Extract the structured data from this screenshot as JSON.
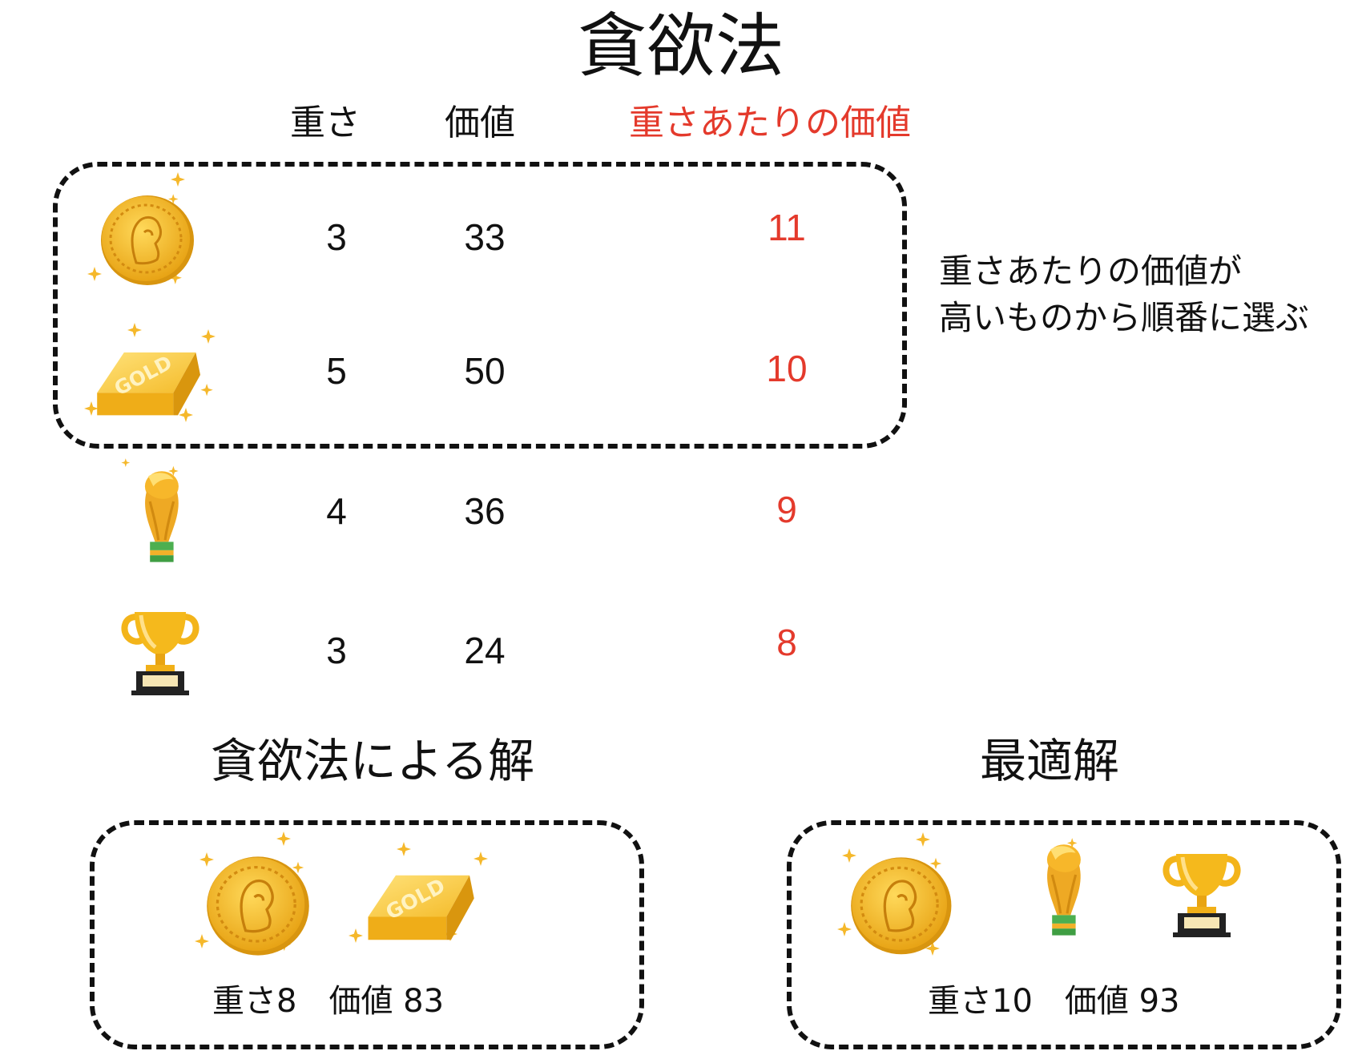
{
  "title": "貪欲法",
  "columns": {
    "weight": "重さ",
    "value": "価値",
    "ratio": "重さあたりの価値"
  },
  "items": [
    {
      "icon": "gold-coin-icon",
      "weight": "3",
      "value": "33",
      "ratio": "11"
    },
    {
      "icon": "gold-bar-icon",
      "weight": "5",
      "value": "50",
      "ratio": "10"
    },
    {
      "icon": "world-cup-trophy-icon",
      "weight": "4",
      "value": "36",
      "ratio": "9"
    },
    {
      "icon": "trophy-cup-icon",
      "weight": "3",
      "value": "24",
      "ratio": "8"
    }
  ],
  "note": {
    "line1": "重さあたりの価値が",
    "line2": "高いものから順番に選ぶ"
  },
  "greedy": {
    "heading": "貪欲法による解",
    "summary": "重さ8　価値 83",
    "icons": [
      "gold-coin-icon",
      "gold-bar-icon"
    ]
  },
  "optimal": {
    "heading": "最適解",
    "summary": "重さ10　価値 93",
    "icons": [
      "gold-coin-icon",
      "world-cup-trophy-icon",
      "trophy-cup-icon"
    ]
  },
  "colors": {
    "accent": "#e43a2c",
    "gold": "#f2b418",
    "dash": "#111111"
  }
}
